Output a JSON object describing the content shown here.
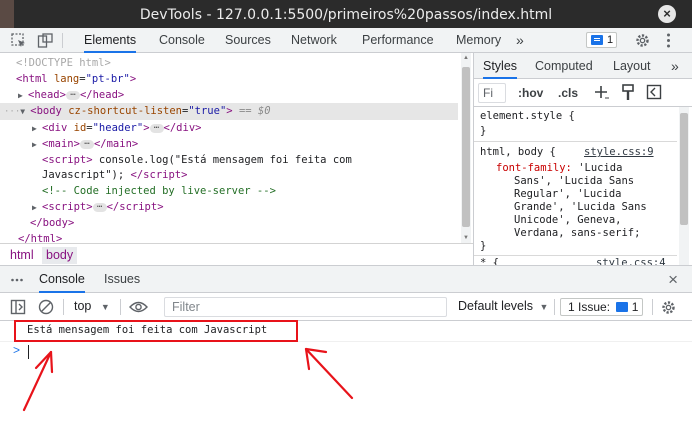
{
  "window": {
    "title": "DevTools - 127.0.0.1:5500/primeiros%20passos/index.html"
  },
  "main_tabs": [
    {
      "label": "Elements",
      "active": true
    },
    {
      "label": "Console"
    },
    {
      "label": "Sources"
    },
    {
      "label": "Network"
    },
    {
      "label": "Performance"
    },
    {
      "label": "Memory"
    }
  ],
  "more_tabs": "»",
  "issues_count": "1",
  "dom": {
    "doctype": "<!DOCTYPE html>",
    "html_tag": "html",
    "html_attr": "lang",
    "html_val": "\"pt-br\"",
    "head_tag": "head",
    "body_tag": "body",
    "body_attr": "cz-shortcut-listen",
    "body_val": "\"true\"",
    "selected_marker": "== $0",
    "div_tag": "div",
    "div_attr": "id",
    "div_val": "\"header\"",
    "main_tag": "main",
    "script_tag": "script",
    "script_text_1": "console.log(\"Está mensagem foi feita com",
    "script_text_2": "Javascript\");",
    "comment": "<!-- Code injected by live-server -->"
  },
  "breadcrumbs": [
    "html",
    "body"
  ],
  "styles_panel": {
    "tabs": [
      "Styles",
      "Computed",
      "Layout"
    ],
    "more": "»",
    "filter_placeholder": "Fi",
    "hov": ":hov",
    "cls": ".cls",
    "element_style": "element.style {",
    "close_brace": "}",
    "rule_selector": "html, body {",
    "rule_source": "style.css:9",
    "font_family_prop": "font-family:",
    "font_family_lines": [
      "'Lucida",
      "Sans', 'Lucida Sans",
      "Regular', 'Lucida",
      "Grande', 'Lucida Sans",
      "Unicode', Geneva,",
      "Verdana, sans-serif;"
    ],
    "next_rule": "* {",
    "next_source": "style.css:4"
  },
  "drawer": {
    "tabs": [
      "Console",
      "Issues"
    ],
    "context": "top",
    "filter_placeholder": "Filter",
    "levels": "Default levels",
    "issues_label": "1 Issue:",
    "issues_count": "1"
  },
  "console": {
    "log": "Está mensagem foi feita com Javascript",
    "prompt": ">"
  },
  "colors": {
    "accent": "#1a73e8",
    "annotation": "#e8131a",
    "title_bar": "#2b2b2b"
  }
}
